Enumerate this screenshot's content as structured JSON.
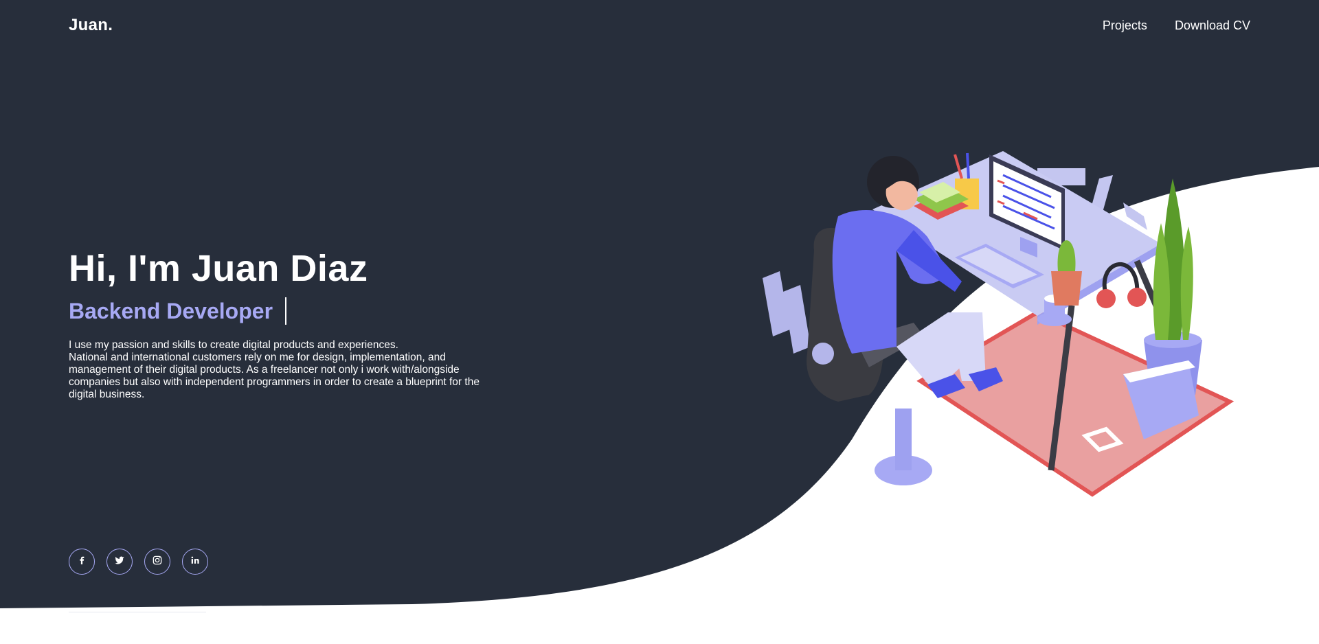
{
  "navbar": {
    "logo": "Juan.",
    "links": [
      {
        "label": "Projects"
      },
      {
        "label": "Download CV"
      }
    ]
  },
  "hero": {
    "title": "Hi, I'm Juan Diaz",
    "role": "Backend Developer",
    "description": [
      "I use my passion and skills to create digital products and experiences.",
      "National and international customers rely on me for design, implementation, and management of their digital products. As a freelancer not only i work with/alongside companies but also with independent programmers in order to create a blueprint for the digital business."
    ]
  },
  "social": [
    {
      "icon": "facebook-icon"
    },
    {
      "icon": "twitter-icon"
    },
    {
      "icon": "instagram-icon"
    },
    {
      "icon": "linkedin-icon"
    }
  ],
  "colors": {
    "background_dark": "#272e3b",
    "accent": "#a7a9f4",
    "text": "#ffffff",
    "page": "#ffffff"
  }
}
